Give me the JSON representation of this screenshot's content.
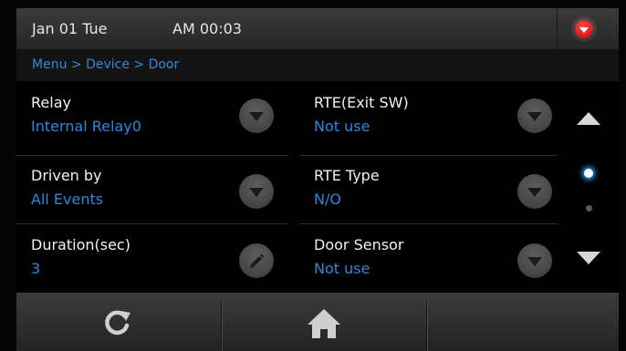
{
  "status_bar": {
    "date": "Jan 01 Tue",
    "time": "AM 00:03"
  },
  "breadcrumb": "Menu > Device > Door",
  "fields": {
    "relay": {
      "label": "Relay",
      "value": "Internal Relay0"
    },
    "rte_exit_sw": {
      "label": "RTE(Exit SW)",
      "value": "Not use"
    },
    "driven_by": {
      "label": "Driven by",
      "value": "All Events"
    },
    "rte_type": {
      "label": "RTE Type",
      "value": "N/O"
    },
    "duration": {
      "label": "Duration(sec)",
      "value": "3"
    },
    "door_sensor": {
      "label": "Door Sensor",
      "value": "Not use"
    }
  },
  "pagination": {
    "current_page": 1,
    "total_pages": 2
  },
  "icons": [
    "alert-icon",
    "dropdown-icon",
    "edit-icon",
    "scroll-up-icon",
    "scroll-down-icon",
    "refresh-icon",
    "home-icon"
  ],
  "colors": {
    "value_text": "#2f88dd",
    "breadcrumb": "#3a86d6",
    "alert": "#e00000",
    "page_indicator": "#2aa4ff"
  }
}
